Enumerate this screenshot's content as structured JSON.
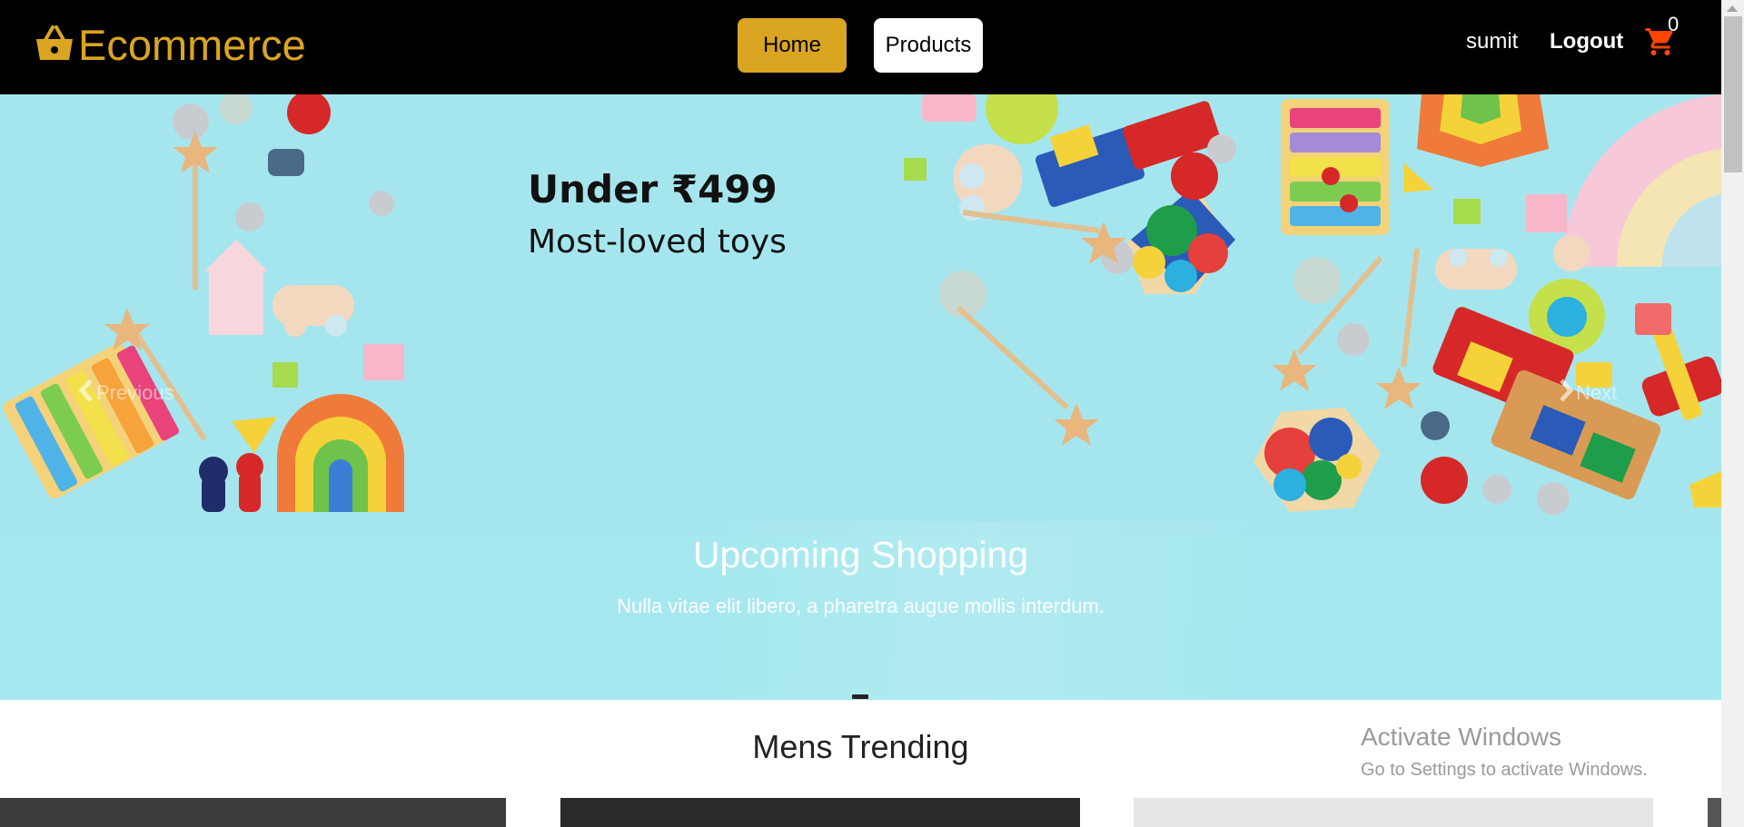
{
  "navbar": {
    "brand": "Ecommerce",
    "home_label": "Home",
    "products_label": "Products",
    "username": "sumit",
    "logout_label": "Logout",
    "cart_count": "0"
  },
  "hero": {
    "promo_price": "Under ₹499",
    "promo_subtitle": "Most-loved toys",
    "prev_label": "Previous",
    "next_label": "Next",
    "caption_title": "Upcoming Shopping",
    "caption_text": "Nulla vitae elit libero, a pharetra augue mollis interdum."
  },
  "section": {
    "title": "Mens Trending"
  },
  "watermark": {
    "line1": "Activate Windows",
    "line2": "Go to Settings to activate Windows."
  },
  "icons": {
    "brand": "shopping-basket-icon",
    "cart": "shopping-cart-icon",
    "prev": "chevron-left-icon",
    "next": "chevron-right-icon"
  },
  "colors": {
    "brand": "#daa520",
    "navbar_bg": "#000000",
    "hero_bg": "#a5e6ee",
    "cart": "#ff4500"
  }
}
